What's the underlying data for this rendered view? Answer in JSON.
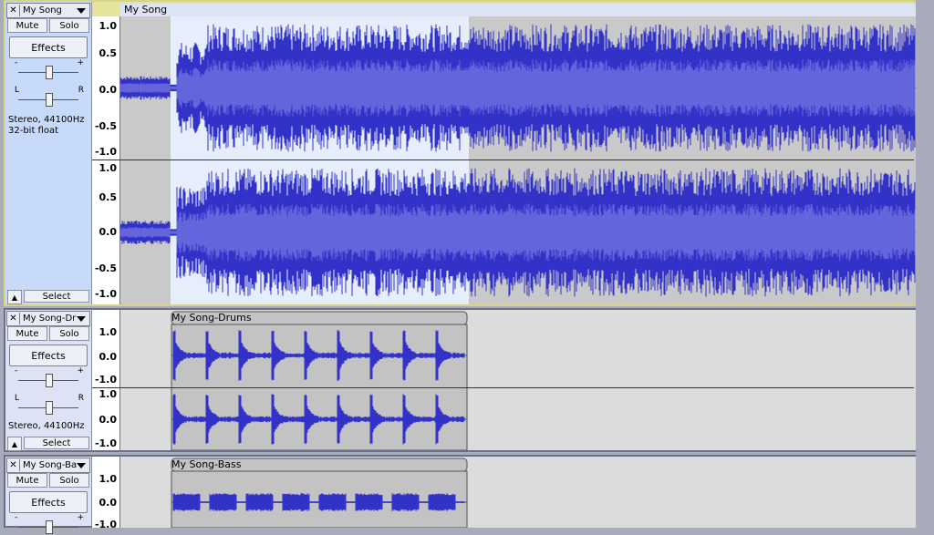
{
  "tracks": [
    {
      "name": "My Song",
      "clip_name": "My Song",
      "mute": "Mute",
      "solo": "Solo",
      "effects": "Effects",
      "gain_min": "-",
      "gain_max": "+",
      "pan_left": "L",
      "pan_right": "R",
      "info_line1": "Stereo, 44100Hz",
      "info_line2": "32-bit float",
      "select": "Select",
      "ruler_ticks": [
        "1.0",
        "0.5",
        "0.0",
        "-0.5",
        "-1.0"
      ]
    },
    {
      "name": "My Song-Dru",
      "clip_name": "My Song-Drums",
      "mute": "Mute",
      "solo": "Solo",
      "effects": "Effects",
      "gain_min": "-",
      "gain_max": "+",
      "pan_left": "L",
      "pan_right": "R",
      "info_line1": "Stereo, 44100Hz",
      "select": "Select",
      "ruler_ticks": [
        "1.0",
        "0.0",
        "-1.0"
      ]
    },
    {
      "name": "My Song-Ba",
      "clip_name": "My Song-Bass",
      "mute": "Mute",
      "solo": "Solo",
      "effects": "Effects",
      "gain_min": "-",
      "gain_max": "+",
      "ruler_ticks": [
        "1.0",
        "0.0",
        "-1.0"
      ]
    }
  ],
  "colors": {
    "waveform": "#3232c8",
    "waveform_rms": "#6464dc",
    "selected_background": "#e6edfb",
    "unselected_background": "#c9c9c9"
  }
}
